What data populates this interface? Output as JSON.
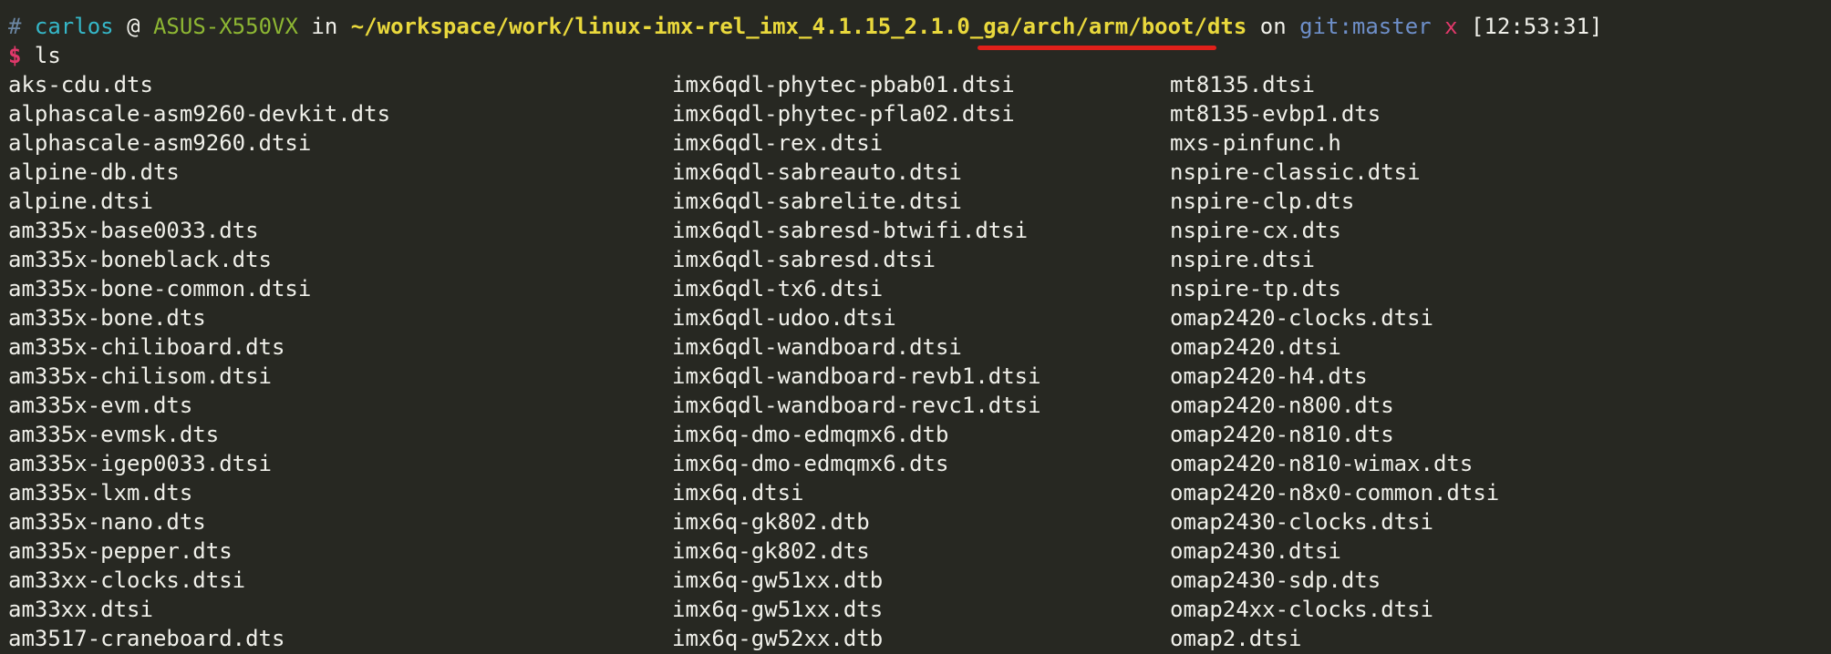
{
  "prompt": {
    "hash": "#",
    "user": "carlos",
    "at": "@",
    "host": "ASUS-X550VX",
    "in_word": "in",
    "path_prefix": "~/workspace/work/linux-imx-rel_imx_4.1.15_2.1.0_ga",
    "path_highlight": "/arch/arm/boot/dts",
    "on_word": "on",
    "git_label": "git:",
    "branch": "master",
    "dirty_marker": "x",
    "time": "[12:53:31]"
  },
  "command": {
    "dollar": "$",
    "text": "ls"
  },
  "annotation": {
    "underline_color": "#e0201a"
  },
  "listing": {
    "columns": [
      [
        "aks-cdu.dts",
        "alphascale-asm9260-devkit.dts",
        "alphascale-asm9260.dtsi",
        "alpine-db.dts",
        "alpine.dtsi",
        "am335x-base0033.dts",
        "am335x-boneblack.dts",
        "am335x-bone-common.dtsi",
        "am335x-bone.dts",
        "am335x-chiliboard.dts",
        "am335x-chilisom.dtsi",
        "am335x-evm.dts",
        "am335x-evmsk.dts",
        "am335x-igep0033.dtsi",
        "am335x-lxm.dts",
        "am335x-nano.dts",
        "am335x-pepper.dts",
        "am33xx-clocks.dtsi",
        "am33xx.dtsi",
        "am3517-craneboard.dts"
      ],
      [
        "imx6qdl-phytec-pbab01.dtsi",
        "imx6qdl-phytec-pfla02.dtsi",
        "imx6qdl-rex.dtsi",
        "imx6qdl-sabreauto.dtsi",
        "imx6qdl-sabrelite.dtsi",
        "imx6qdl-sabresd-btwifi.dtsi",
        "imx6qdl-sabresd.dtsi",
        "imx6qdl-tx6.dtsi",
        "imx6qdl-udoo.dtsi",
        "imx6qdl-wandboard.dtsi",
        "imx6qdl-wandboard-revb1.dtsi",
        "imx6qdl-wandboard-revc1.dtsi",
        "imx6q-dmo-edmqmx6.dtb",
        "imx6q-dmo-edmqmx6.dts",
        "imx6q.dtsi",
        "imx6q-gk802.dtb",
        "imx6q-gk802.dts",
        "imx6q-gw51xx.dtb",
        "imx6q-gw51xx.dts",
        "imx6q-gw52xx.dtb"
      ],
      [
        "mt8135.dtsi",
        "mt8135-evbp1.dts",
        "mxs-pinfunc.h",
        "nspire-classic.dtsi",
        "nspire-clp.dts",
        "nspire-cx.dts",
        "nspire.dtsi",
        "nspire-tp.dts",
        "omap2420-clocks.dtsi",
        "omap2420.dtsi",
        "omap2420-h4.dts",
        "omap2420-n800.dts",
        "omap2420-n810.dts",
        "omap2420-n810-wimax.dts",
        "omap2420-n8x0-common.dtsi",
        "omap2430-clocks.dtsi",
        "omap2430.dtsi",
        "omap2430-sdp.dts",
        "omap24xx-clocks.dtsi",
        "omap2.dtsi"
      ]
    ]
  }
}
